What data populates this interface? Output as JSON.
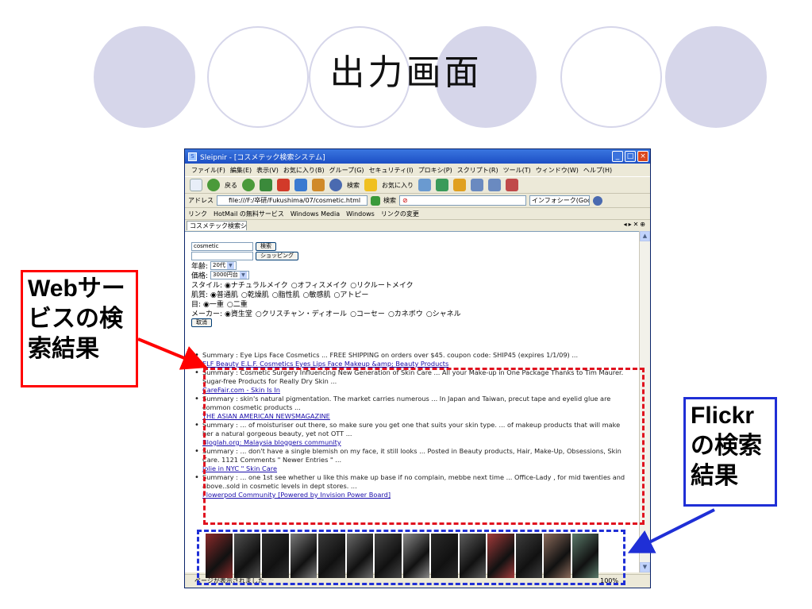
{
  "slide": {
    "title": "出力画面"
  },
  "callouts": {
    "web_service": "Webサービスの検索結果",
    "flickr": "Flickrの検索結果"
  },
  "browser": {
    "title": "Sleipnir - [コスメテック検索システム]",
    "menu": [
      "ファイル(F)",
      "編集(E)",
      "表示(V)",
      "お気に入り(B)",
      "グループ(G)",
      "セキュリティ(I)",
      "プロキシ(P)",
      "スクリプト(R)",
      "ツール(T)",
      "ウィンドウ(W)",
      "ヘルプ(H)"
    ],
    "toolbar": {
      "back_label": "戻る",
      "search_label": "検索",
      "favorites_label": "お気に入り"
    },
    "address": {
      "label": "アドレス",
      "value": "file:///F:/卒研/Fukushima/07/cosmetic.html",
      "search_label": "検索",
      "engine": "インフォシーク(Google)"
    },
    "links": {
      "label": "リンク",
      "items": [
        "HotMail の無料サービス",
        "Windows Media",
        "Windows",
        "リンクの変更"
      ]
    },
    "tab": {
      "label": "コスメテック検索シ..."
    },
    "status": "ページが表示されました",
    "zoom": "100%"
  },
  "form": {
    "query": "cosmetic",
    "search_button": "検索",
    "shopping_button": "ショッピング",
    "age_label": "年齢:",
    "age_value": "20代",
    "price_label": "価格:",
    "price_value": "3000円台",
    "style_label": "スタイル:",
    "style_options": [
      "ナチュラルメイク",
      "オフィスメイク",
      "リクルートメイク"
    ],
    "skin_label": "肌質:",
    "skin_options": [
      "普通肌",
      "乾燥肌",
      "脂性肌",
      "敏感肌",
      "アトピー"
    ],
    "eye_label": "目:",
    "eye_options": [
      "一重",
      "二重"
    ],
    "maker_label": "メーカー:",
    "maker_options": [
      "資生堂",
      "クリスチャン・ディオール",
      "コーセー",
      "カネボウ",
      "シャネル"
    ],
    "cancel_button": "取消"
  },
  "results": [
    {
      "summary": "Summary : Eye Lips Face Cosmetics ... FREE SHIPPING on orders over $45. coupon code: SHIP45 (expires 1/1/09) ...",
      "link": "ELF Beauty E.L.F. Cosmetics Eyes Lips Face Makeup &amp; Beauty Products"
    },
    {
      "summary": "Summary : Cosmetic Surgery Influencing New Generation of Skin Care ... All your Make-up in One Package Thanks to Tim Maurer. Sugar-free Products for Really Dry Skin ...",
      "link": "CareFair.com - Skin Is In"
    },
    {
      "summary": "Summary : skin's natural pigmentation. The market carries numerous ... In Japan and Taiwan, precut tape and eyelid glue are common cosmetic products ...",
      "link": "THE ASIAN AMERICAN NEWSMAGAZINE"
    },
    {
      "summary": "Summary : ... of moisturiser out there, so make sure you get one that suits your skin type. ... of makeup products that will make her a natural gorgeous beauty, yet not OTT ...",
      "link": "Bloglah.org: Malaysia bloggers community"
    },
    {
      "summary": "Summary : ... don't have a single blemish on my face, it still looks ... Posted in Beauty products, Hair, Make-Up, Obsessions, Skin Care. 1121 Comments \" Newer Entries \" ...",
      "link": "Jolie in NYC \" Skin Care"
    },
    {
      "summary": "Summary : ... one 1st see whether u like this make up base if no complain, mebbe next time ... Office-Lady , for mid twenties and above..sold in cosmetic levels in dept stores. ...",
      "link": "Flowerpod Community [Powered by Invision Power Board]"
    }
  ],
  "flickr_thumbs": [
    "#8b2a2a",
    "#505050",
    "#2f2f2f",
    "#7a7a7a",
    "#3a3a3a",
    "#6b6b6b",
    "#454545",
    "#888888",
    "#2a2a2a",
    "#5c5c5c",
    "#a33a3a",
    "#3d3d3d",
    "#8a6a5a",
    "#5a7a6a"
  ],
  "colors": {
    "circle": "#d6d6ea",
    "red_callout": "#ff0000",
    "blue_callout": "#1f2fd6",
    "link": "#1a0dab"
  }
}
